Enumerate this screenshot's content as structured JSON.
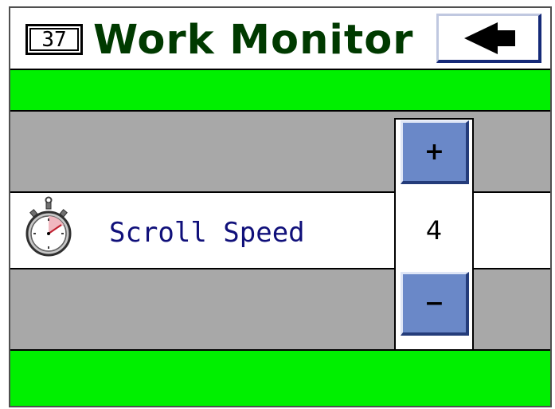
{
  "header": {
    "screen_number": "37",
    "title": "Work Monitor",
    "back_icon": "left-arrow-icon"
  },
  "setting": {
    "icon": "stopwatch-icon",
    "label": "Scroll Speed",
    "value": "4",
    "increment_label": "+",
    "decrement_label": "−"
  },
  "colors": {
    "status_bar": "#00f000",
    "title_text": "#003a00",
    "button_fill": "#6a88c8",
    "label_text": "#10107a",
    "background": "#a8a8a8"
  }
}
